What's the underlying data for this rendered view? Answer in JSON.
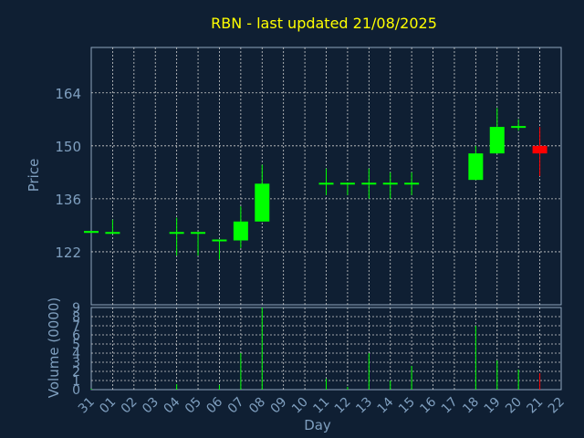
{
  "chart_data": {
    "type": "candlestick",
    "title": "RBN - last updated 21/08/2025",
    "xlabel": "Day",
    "ylabel_price": "Price",
    "ylabel_volume": "Volume (0000)",
    "x_ticks": [
      "31",
      "01",
      "02",
      "03",
      "04",
      "05",
      "06",
      "07",
      "08",
      "09",
      "10",
      "11",
      "12",
      "13",
      "14",
      "15",
      "16",
      "17",
      "18",
      "19",
      "20",
      "21",
      "22"
    ],
    "price_ticks": [
      122,
      136,
      150,
      164
    ],
    "price_ylim": [
      108,
      176
    ],
    "volume_ticks": [
      0,
      1,
      2,
      3,
      4,
      5,
      6,
      7,
      8,
      9
    ],
    "volume_ylim": [
      0,
      9
    ],
    "grid": true,
    "colors": {
      "background": "#0f1f33",
      "up": "#00ff00",
      "down": "#ff0000",
      "title": "#ffff00",
      "axis_text": "#7f9fbf",
      "grid": "#cfcfcf"
    },
    "candles": [
      {
        "day": "31",
        "open": 127,
        "high": 127.5,
        "low": 127,
        "close": 127.5,
        "volume": 0.1
      },
      {
        "day": "01",
        "open": 127,
        "high": 130.5,
        "low": 127,
        "close": 127,
        "volume": 0
      },
      {
        "day": "04",
        "open": 127,
        "high": 131,
        "low": 121,
        "close": 127,
        "volume": 0.6
      },
      {
        "day": "05",
        "open": 127,
        "high": 127,
        "low": 121,
        "close": 127,
        "volume": 0
      },
      {
        "day": "06",
        "open": 125,
        "high": 125,
        "low": 120,
        "close": 125,
        "volume": 0.5
      },
      {
        "day": "07",
        "open": 125,
        "high": 134,
        "low": 123,
        "close": 130,
        "volume": 4
      },
      {
        "day": "08",
        "open": 130,
        "high": 145,
        "low": 130,
        "close": 140,
        "volume": 9
      },
      {
        "day": "11",
        "open": 140,
        "high": 144,
        "low": 137,
        "close": 140,
        "volume": 1.2
      },
      {
        "day": "12",
        "open": 140,
        "high": 140,
        "low": 137,
        "close": 140,
        "volume": 0.3
      },
      {
        "day": "13",
        "open": 140,
        "high": 144,
        "low": 136,
        "close": 140,
        "volume": 4
      },
      {
        "day": "14",
        "open": 140,
        "high": 143,
        "low": 136,
        "close": 140,
        "volume": 1
      },
      {
        "day": "15",
        "open": 140,
        "high": 143,
        "low": 137,
        "close": 140,
        "volume": 2.6
      },
      {
        "day": "18",
        "open": 141,
        "high": 150,
        "low": 141,
        "close": 148,
        "volume": 7
      },
      {
        "day": "19",
        "open": 148,
        "high": 160,
        "low": 148,
        "close": 155,
        "volume": 3.2
      },
      {
        "day": "20",
        "open": 155,
        "high": 157,
        "low": 154,
        "close": 155,
        "volume": 2.2
      },
      {
        "day": "21",
        "open": 150,
        "high": 155,
        "low": 142,
        "close": 148,
        "volume": 1.8
      }
    ]
  }
}
